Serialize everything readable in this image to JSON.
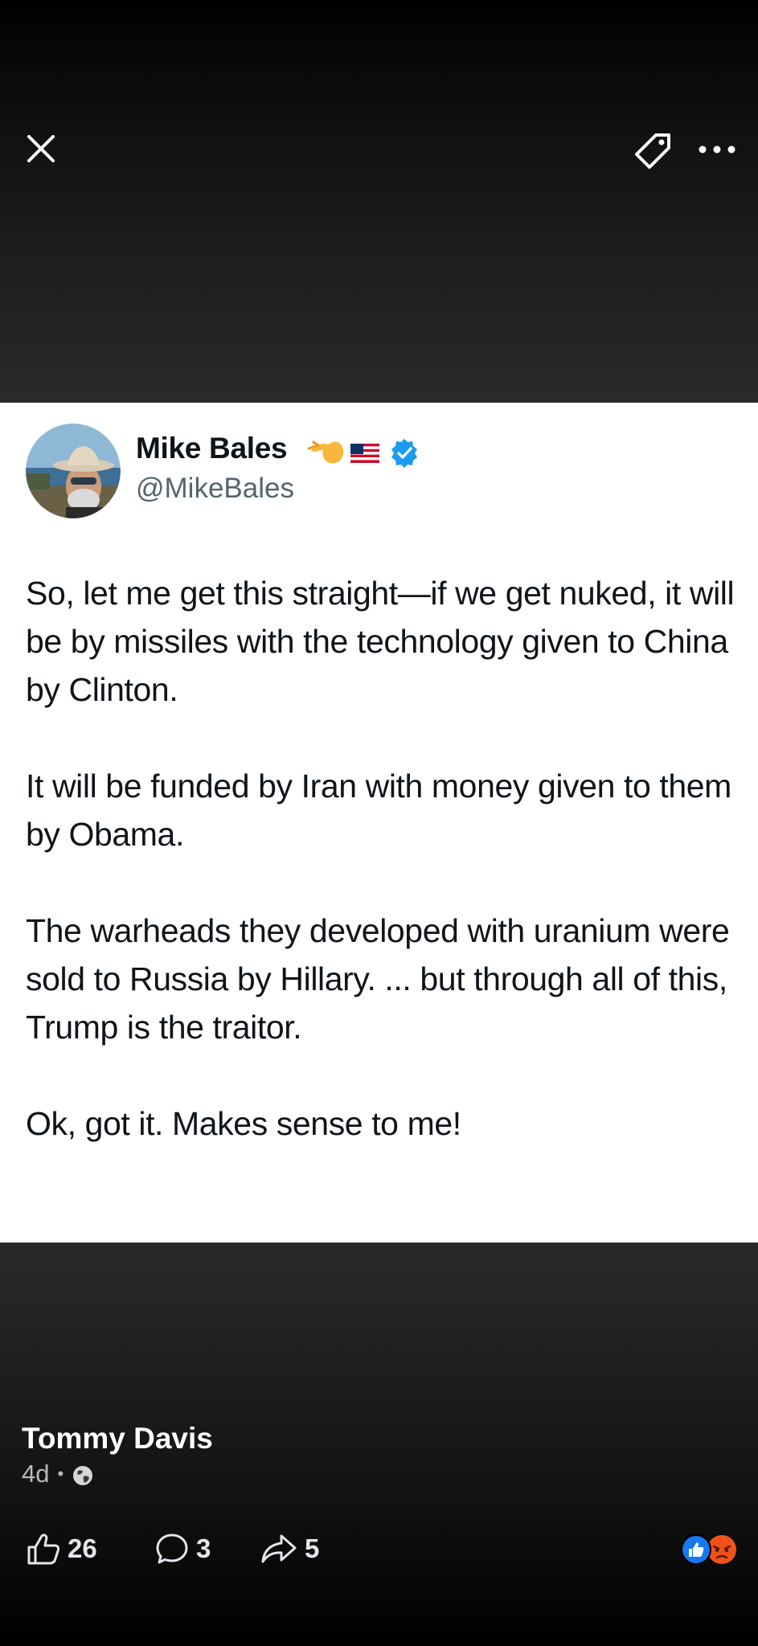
{
  "viewer": {
    "close_icon": "close-icon",
    "tag_icon": "tag-icon",
    "more_icon": "more-options-icon"
  },
  "tweet": {
    "display_name": "Mike Bales",
    "name_emojis": [
      "pointing-hand-emoji",
      "us-flag-emoji",
      "verified-badge-icon"
    ],
    "handle": "@MikeBales",
    "paragraphs": [
      "So, let me get this straight—if we get nuked, it will be by missiles with the technology given to China by Clinton.",
      "It will be funded by Iran with money given to them by Obama.",
      "The warheads they developed with uranium were sold to Russia by Hillary. ... but through all of this, Trump is the traitor.",
      "Ok, got it. Makes sense to me!"
    ]
  },
  "post": {
    "author": "Tommy Davis",
    "age": "4d",
    "separator": "•",
    "audience_icon": "globe-icon"
  },
  "actions": {
    "likes": "26",
    "comments": "3",
    "shares": "5"
  },
  "reactions": [
    "like-reaction-icon",
    "angry-reaction-icon"
  ],
  "colors": {
    "tweet_text": "#0f1419",
    "tweet_handle": "#536471",
    "verified_blue": "#1d9bf0",
    "fb_blue": "#1877f2",
    "angry_orange": "#f0521c"
  }
}
